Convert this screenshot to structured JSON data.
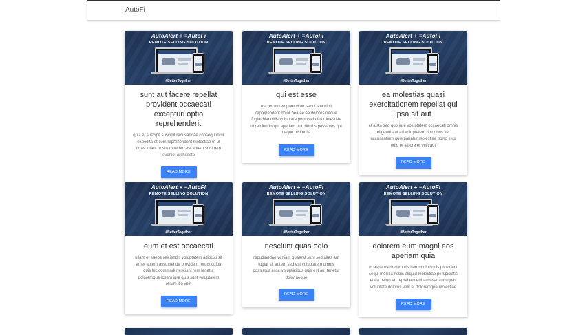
{
  "navbar": {
    "brand": "AutoFi"
  },
  "banner": {
    "logo_text": "AutoAlert + ≡AutoFi",
    "subtitle": "REMOTE SELLING SOLUTION",
    "hashtag": "#BetterTogether"
  },
  "cards": [
    {
      "title": "sunt aut facere repellat provident occaecati excepturi optio reprehenderit",
      "body": "quia et suscipit suscipit recusandae consequuntur expedita et cum reprehenderit molestiae ut ut quas totam nostrum rerum est autem sunt rem eveniet architecto",
      "button": "READ MORE"
    },
    {
      "title": "qui est esse",
      "body": "est rerum tempore vitae sequi sint nihil reprehenderit dolor beatae ea dolores neque fugiat blanditiis voluptate porro vel nihil molestiae ut reiciendis qui aperiam non debitis possimus qui neque nisi nulla",
      "button": "READ MORE"
    },
    {
      "title": "ea molestias quasi exercitationem repellat qui ipsa sit aut",
      "body": "et iusto sed quo iure voluptatem occaecati omnis eligendi aut ad voluptatem doloribus vel accusantium quis pariatur molestiae porro eius odio et labore et velit aut",
      "button": "READ MORE"
    },
    {
      "title": "eum et est occaecati",
      "body": "ullam et saepe reiciendis voluptatem adipisci sit amet autem assumenda provident rerum culpa quis hic commodi nesciunt rem tenetur doloremque ipsam iure quis sunt voluptatem rerum illo velit",
      "button": "READ MORE"
    },
    {
      "title": "nesciunt quas odio",
      "body": "repudiandae veniam quaerat sunt sed alias aut fugiat sit autem sed est voluptatem omnis possimus esse voluptatibus quis est aut tenetur dolor neque",
      "button": "READ MORE"
    },
    {
      "title": "dolorem eum magni eos aperiam quia",
      "body": "ut aspernatur corporis harum nihil quis provident sequi mollitia nobis aliquid molestiae perspiciatis et ea nemo ab reprehenderit accusantium quas voluptate dolores velit et doloremque molestiae",
      "button": "READ MORE"
    }
  ]
}
